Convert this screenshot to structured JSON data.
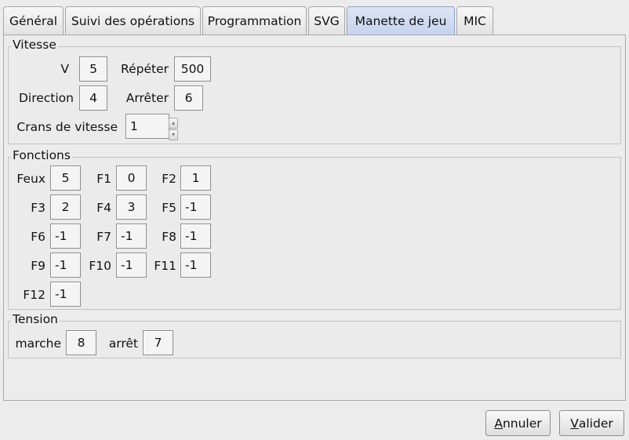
{
  "tabs": [
    {
      "label": "Général",
      "active": false
    },
    {
      "label": "Suivi des opérations",
      "active": false
    },
    {
      "label": "Programmation",
      "active": false
    },
    {
      "label": "SVG",
      "active": false
    },
    {
      "label": "Manette de jeu",
      "active": true
    },
    {
      "label": "MIC",
      "active": false
    }
  ],
  "vitesse": {
    "title": "Vitesse",
    "v_label": "V",
    "v_value": "5",
    "repeter_label": "Répéter",
    "repeter_value": "500",
    "direction_label": "Direction",
    "direction_value": "4",
    "arreter_label": "Arrêter",
    "arreter_value": "6",
    "crans_label": "Crans de vitesse",
    "crans_value": "1"
  },
  "fonctions": {
    "title": "Fonctions",
    "items": [
      {
        "label": "Feux",
        "value": "5"
      },
      {
        "label": "F1",
        "value": "0"
      },
      {
        "label": "F2",
        "value": "1"
      },
      {
        "label": "F3",
        "value": "2"
      },
      {
        "label": "F4",
        "value": "3"
      },
      {
        "label": "F5",
        "value": "-1"
      },
      {
        "label": "F6",
        "value": "-1"
      },
      {
        "label": "F7",
        "value": "-1"
      },
      {
        "label": "F8",
        "value": "-1"
      },
      {
        "label": "F9",
        "value": "-1"
      },
      {
        "label": "F10",
        "value": "-1"
      },
      {
        "label": "F11",
        "value": "-1"
      },
      {
        "label": "F12",
        "value": "-1"
      }
    ]
  },
  "tension": {
    "title": "Tension",
    "marche_label": "marche",
    "marche_value": "8",
    "arret_label": "arrêt",
    "arret_value": "7"
  },
  "buttons": {
    "cancel_mnemonic": "A",
    "cancel_rest": "nnuler",
    "ok_mnemonic": "V",
    "ok_rest": "alider"
  }
}
